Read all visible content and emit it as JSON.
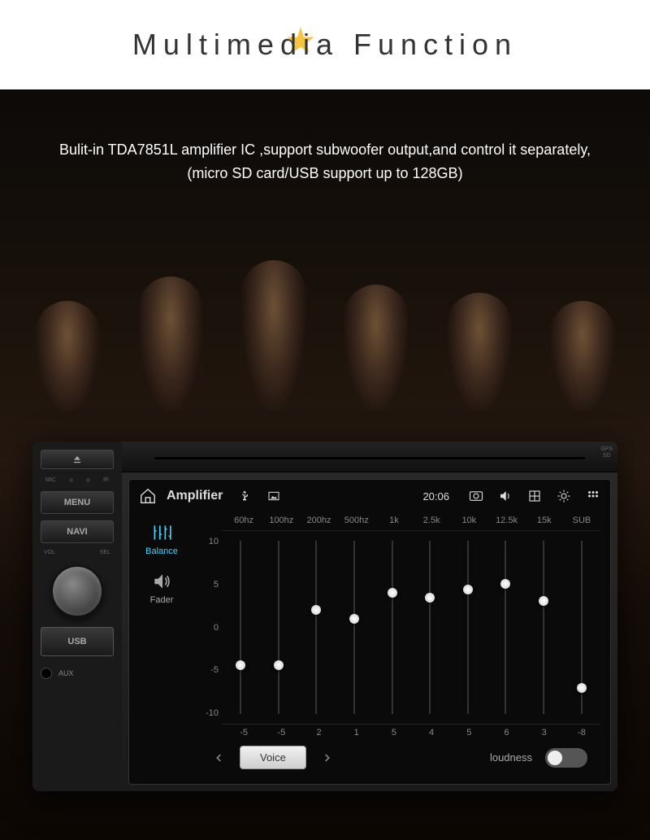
{
  "header": {
    "title": "Multimedia Function"
  },
  "description": "Bulit-in TDA7851L amplifier IC ,support subwoofer output,and control it separately,(micro SD card/USB support up to 128GB)",
  "hardware": {
    "mic": "MIC",
    "ir": "IR",
    "menu": "MENU",
    "navi": "NAVI",
    "vol": "VOL",
    "sel": "SEL",
    "usb": "USB",
    "aux": "AUX",
    "gps": "GPS",
    "sd": "SD"
  },
  "statusbar": {
    "app_title": "Amplifier",
    "time": "20:06"
  },
  "sidebar": {
    "balance": "Balance",
    "fader": "Fader"
  },
  "eq": {
    "bands": [
      "60hz",
      "100hz",
      "200hz",
      "500hz",
      "1k",
      "2.5k",
      "10k",
      "12.5k",
      "15k",
      "SUB"
    ],
    "scale": [
      "10",
      "5",
      "0",
      "-5",
      "-10"
    ],
    "values": [
      -5,
      -5,
      2,
      1,
      5,
      4,
      5,
      6,
      3,
      -8
    ],
    "thumb_pos_pct": [
      72,
      72,
      40,
      45,
      30,
      33,
      28,
      25,
      35,
      85
    ]
  },
  "preset": {
    "current": "Voice",
    "loudness_label": "loudness"
  }
}
